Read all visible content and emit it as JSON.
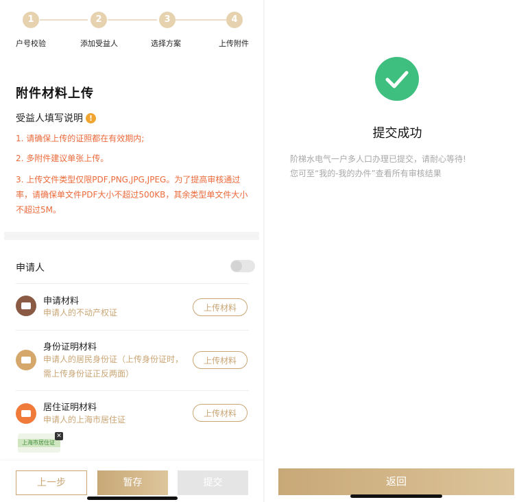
{
  "steps": [
    {
      "number": "1",
      "label": "户号校验"
    },
    {
      "number": "2",
      "label": "添加受益人"
    },
    {
      "number": "3",
      "label": "选择方案"
    },
    {
      "number": "4",
      "label": "上传附件"
    }
  ],
  "upload_page": {
    "title": "附件材料上传",
    "instructions_title": "受益人填写说明",
    "instructions_icon": "!",
    "notes": [
      "1. 请确保上传的证照都在有效期内;",
      "2. 多附件建议单张上传。",
      "3. 上传文件类型仅限PDF,PNG,JPG,JPEG。为了提高审核通过率，请确保单文件PDF大小不超过500KB，其余类型单文件大小不超过5M。"
    ],
    "applicant_label": "申请人",
    "materials": [
      {
        "title": "申请材料",
        "desc": "申请人的不动产权证",
        "button": "上传材料",
        "icon_color": "#8a5a45"
      },
      {
        "title": "身份证明材料",
        "desc": "申请人的居民身份证（上传身份证时，需上传身份证正反两面）",
        "button": "上传材料",
        "icon_color": "#d6a76a"
      },
      {
        "title": "居住证明材料",
        "desc": "申请人的上海市居住证",
        "button": "上传材料",
        "icon_color": "#f07a3a"
      }
    ],
    "thumbnail_text": "上海市居住证",
    "buttons": {
      "prev": "上一步",
      "save": "暂存",
      "submit": "提交"
    }
  },
  "success_page": {
    "title": "提交成功",
    "message_line1": "阶梯水电气一户多人口办理已提交，请耐心等待!",
    "message_line2": "您可至“我的-我的办件”查看所有审核结果",
    "back_button": "返回"
  },
  "colors": {
    "accent_gold": "#c9a574",
    "warning_orange": "#ec6a3b",
    "success_green": "#3fbf7f"
  }
}
